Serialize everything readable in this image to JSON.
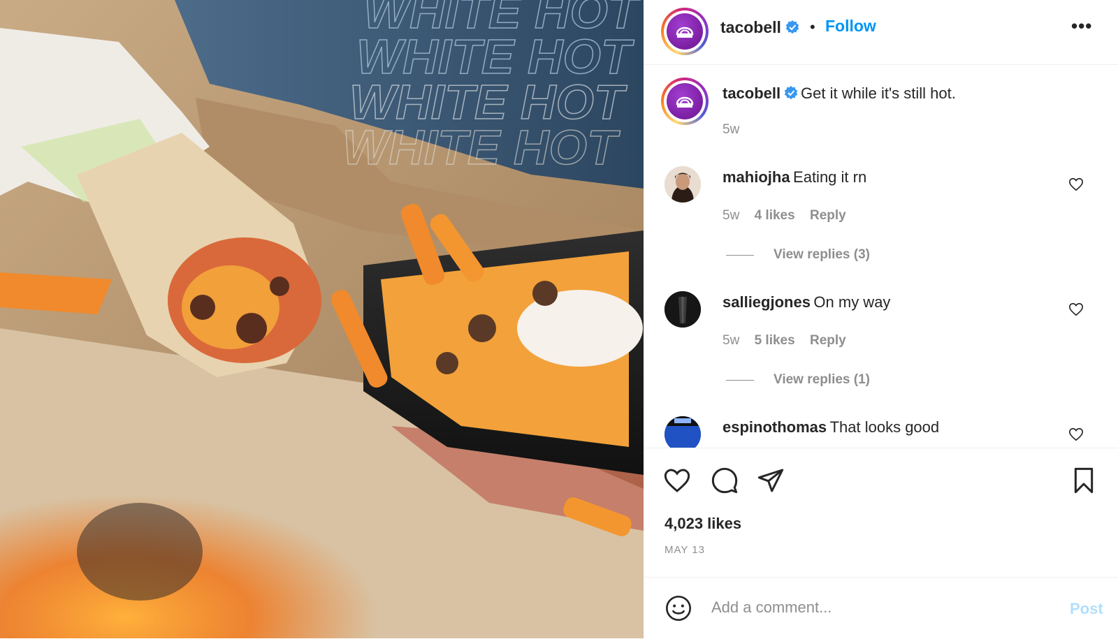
{
  "post": {
    "username": "tacobell",
    "follow_label": "Follow",
    "separator": "•",
    "more_label": "•••",
    "caption": {
      "username": "tacobell",
      "text": "Get it while it's still hot.",
      "time": "5w"
    },
    "photo_overlay_text": "WHITE HOT",
    "comments": [
      {
        "username": "mahiojha",
        "text": "Eating it rn",
        "time": "5w",
        "likes": "4 likes",
        "reply_label": "Reply",
        "view_replies": "View replies (3)"
      },
      {
        "username": "salliegjones",
        "text": "On my way",
        "time": "5w",
        "likes": "5 likes",
        "reply_label": "Reply",
        "view_replies": "View replies (1)"
      },
      {
        "username": "espinothomas",
        "text": "That looks good"
      }
    ],
    "likes_count": "4,023 likes",
    "date": "MAY 13",
    "add_comment_placeholder": "Add a comment...",
    "post_label": "Post"
  },
  "icons": {
    "like": "heart-icon",
    "comment": "comment-icon",
    "share": "paper-plane-icon",
    "save": "bookmark-icon",
    "emoji": "smiley-icon",
    "verified": "verified-badge-icon"
  },
  "colors": {
    "link_blue": "#0095f6",
    "verified_blue": "#3897f0",
    "post_disabled": "#b2dffc",
    "muted": "#8e8e8e",
    "brand_purple": "#7b1fa2"
  }
}
